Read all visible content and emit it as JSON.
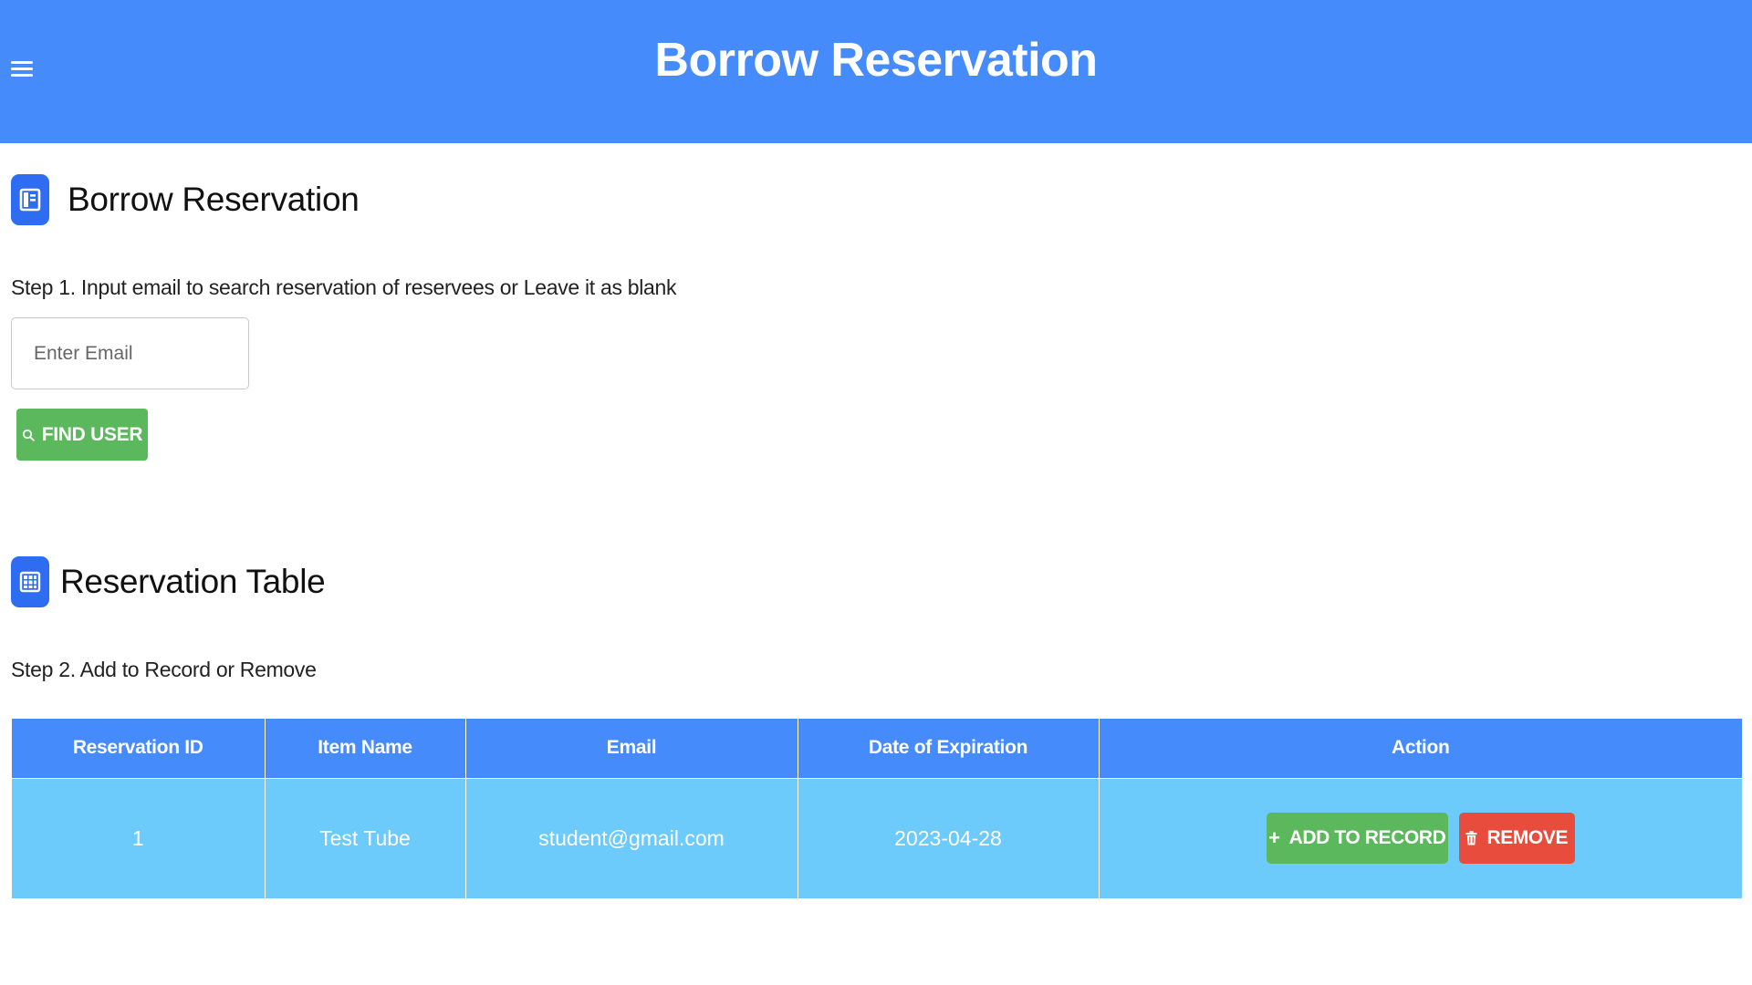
{
  "header": {
    "title": "Borrow Reservation",
    "menu_icon": "hamburger-menu-icon",
    "background_color": "#458bfb"
  },
  "section_borrow": {
    "title": "Borrow Reservation",
    "icon": "sidebar-layout-icon",
    "step_text": "Step 1. Input email to search reservation of reservees or Leave it as blank",
    "email_placeholder": "Enter Email",
    "email_value": "",
    "find_button_label": "FIND USER",
    "find_button_icon": "search-icon"
  },
  "section_table": {
    "title": "Reservation Table",
    "icon": "grid-table-icon",
    "step_text": "Step 2. Add to Record or Remove"
  },
  "table": {
    "columns": [
      "Reservation ID",
      "Item Name",
      "Email",
      "Date of Expiration",
      "Action"
    ],
    "rows": [
      {
        "reservation_id": "1",
        "item_name": "Test Tube",
        "email": "student@gmail.com",
        "date_of_expiration": "2023-04-28",
        "add_label": "ADD TO RECORD",
        "add_icon": "plus-icon",
        "remove_label": "REMOVE",
        "remove_icon": "trash-icon"
      }
    ]
  },
  "colors": {
    "primary": "#458bfb",
    "row_background": "#6ccbfb",
    "success": "#5cb85c",
    "danger": "#e74c3c",
    "icon_badge": "#2e6cf2"
  }
}
